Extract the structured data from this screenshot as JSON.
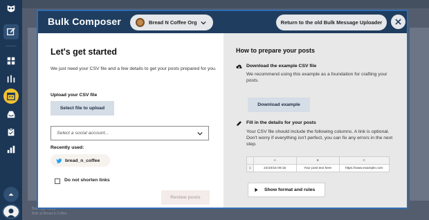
{
  "modal": {
    "title": "Bulk Composer",
    "org_name": "Bread N Coffee Org",
    "return_label": "Return to the old Bulk Message Uploader"
  },
  "left": {
    "title": "Let's get started",
    "description": "We just need your CSV file and a few details to get your posts prepared for you.",
    "upload_label": "Upload your CSV file",
    "upload_button": "Select file to upload",
    "account_placeholder": "Select a social account...",
    "recent_label": "Recently used:",
    "recent_account": "bread_n_coffee",
    "shorten_label": "Do not shorten links",
    "review_button": "Review posts"
  },
  "right": {
    "title": "How to prepare your posts",
    "step1_title": "Download the example CSV file",
    "step1_text": "We recommend using this example as a foundation for crafting your posts.",
    "download_button": "Download example",
    "step2_title": "Fill in the details for your posts",
    "step2_text": "Your CSV file should include the following columns. A link is optional. Don't worry if everything isn't perfect, you can fix any errors in the next step.",
    "table_headers": [
      "A",
      "B",
      "C"
    ],
    "table_row": {
      "num": "1",
      "a": "24/10/16 09:15",
      "b": "Your post text here",
      "c": "https://www.example.com"
    },
    "show_button": "Show format and rules"
  },
  "background": {
    "line1": "Bulk App Twitter",
    "line2": "Bulk at Bread & Coffee"
  },
  "colors": {
    "header": "#1f3d5f",
    "sidebar": "#1c3656",
    "active_icon": "#f2c230",
    "modal_border": "#2f6db5"
  }
}
